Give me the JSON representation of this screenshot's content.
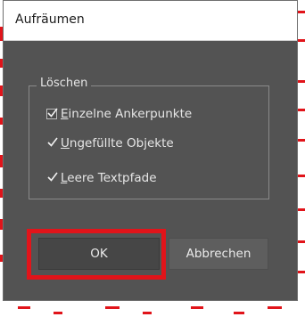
{
  "dialog": {
    "title": "Aufräumen",
    "group_label": "Löschen",
    "options": [
      {
        "label_first": "E",
        "label_rest": "inzelne Ankerpunkte",
        "checked": true
      },
      {
        "label_first": "U",
        "label_rest": "ngefüllte Objekte",
        "checked": true
      },
      {
        "label_first": "L",
        "label_rest": "eere Textpfade",
        "checked": true
      }
    ],
    "buttons": {
      "ok": "OK",
      "cancel": "Abbrechen"
    }
  },
  "colors": {
    "dialog_bg": "#535353",
    "highlight": "#e1141a",
    "background_marks": "#e1141a"
  },
  "icons": [
    "checkmark-icon"
  ]
}
